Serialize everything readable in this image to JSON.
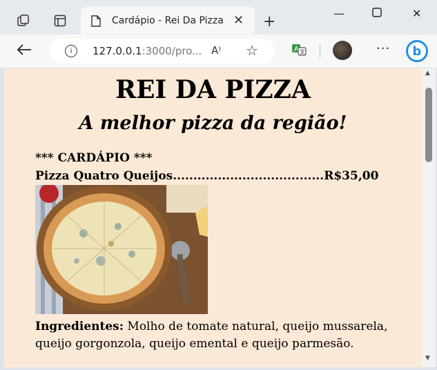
{
  "browser": {
    "tab_title": "Cardápio - Rei Da Pizza",
    "address": {
      "host": "127.0.0.1",
      "rest": ":3000/pro..."
    },
    "icons": {
      "read_aloud": "A⁾"
    }
  },
  "page": {
    "title": "REI DA PIZZA",
    "subtitle": "A melhor pizza da região!",
    "menu_heading": "*** CARDÁPIO ***",
    "item": {
      "name": "Pizza Quatro Queijos.....................................R$35,00"
    },
    "ingredients_label": "Ingredientes:",
    "ingredients_text": " Molho de tomate natural, queijo mussarela, queijo gorgonzola, queijo emental e queijo parmesão."
  },
  "colors": {
    "page_background": "#fbe9d8",
    "tabstrip": "#e6e9ee",
    "bing": "#1f8fe6"
  }
}
